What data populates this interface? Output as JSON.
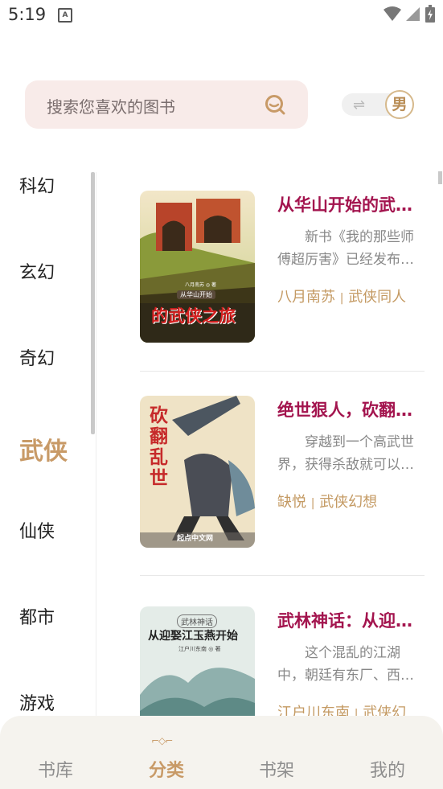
{
  "status": {
    "time": "5:19",
    "notification_icon_text": "A"
  },
  "search": {
    "placeholder": "搜索您喜欢的图书",
    "icon": "search-icon"
  },
  "gender": {
    "swap_icon": "⇌",
    "label": "男"
  },
  "sidebar": {
    "items": [
      {
        "label": "科幻",
        "active": false
      },
      {
        "label": "玄幻",
        "active": false
      },
      {
        "label": "奇幻",
        "active": false
      },
      {
        "label": "武侠",
        "active": true
      },
      {
        "label": "仙侠",
        "active": false
      },
      {
        "label": "都市",
        "active": false
      },
      {
        "label": "游戏",
        "active": false
      }
    ]
  },
  "books": [
    {
      "title": "从华山开始的武…",
      "desc": "新书《我的那些师傅超厉害》已经发布…",
      "author": "八月南苏",
      "genre": "武侠同人",
      "cover_text": "的武侠之旅",
      "cover_sub": "从华山开始",
      "cover_author": "八月南苏 ◎ 著"
    },
    {
      "title": "绝世狠人，砍翻…",
      "desc": "穿越到一个高武世界，获得杀敌就可以…",
      "author": "缺悦",
      "genre": "武侠幻想",
      "cover_text": "砍翻乱世",
      "cover_sub": "起点中文网",
      "cover_author": ""
    },
    {
      "title": "武林神话：从迎…",
      "desc": "这个混乱的江湖中，朝廷有东厂、西…",
      "author": "江户川东南",
      "genre": "武侠幻",
      "cover_text": "从迎娶江玉燕开始",
      "cover_sub": "武林神话",
      "cover_author": "江户川东南 ◎ 著"
    }
  ],
  "tabs": [
    {
      "label": "书库",
      "active": false
    },
    {
      "label": "分类",
      "active": true
    },
    {
      "label": "书架",
      "active": false
    },
    {
      "label": "我的",
      "active": false
    }
  ],
  "tab_indicator": "⌐◇⌐",
  "colors": {
    "accent": "#c89a67",
    "title": "#a3144e",
    "search_bg": "#f8ebe9"
  }
}
